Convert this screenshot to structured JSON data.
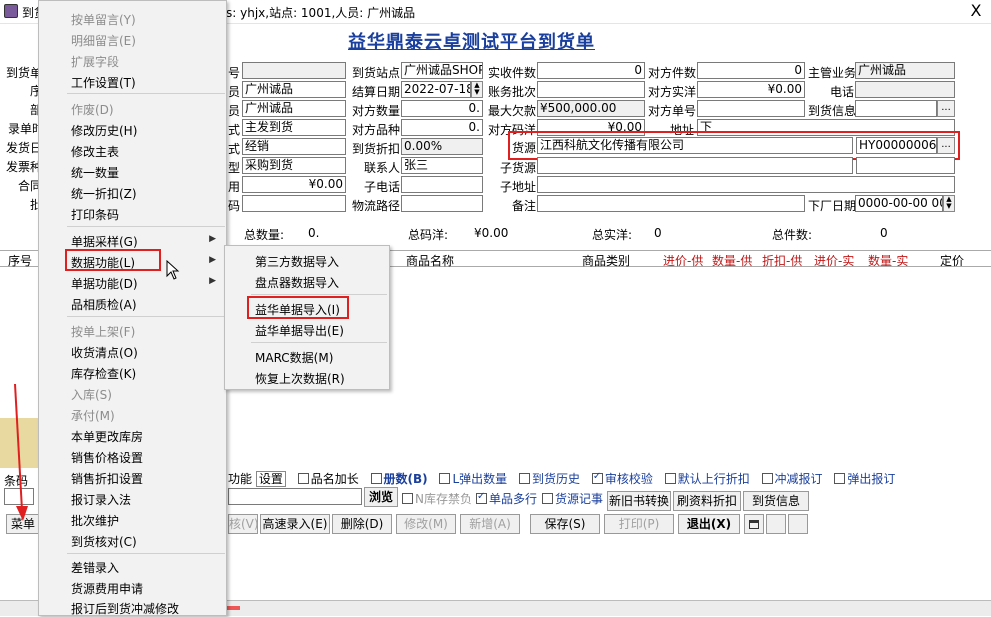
{
  "window": {
    "title": "到货",
    "user_info": "s: yhjx,站点: 1001,人员: 广州诚品",
    "close_label": "X"
  },
  "app_title": "益华鼎泰云卓测试平台到货单",
  "left_labels": [
    "到货单",
    "序",
    "部",
    "录单时",
    "发货日",
    "发票种",
    "合同",
    "批"
  ],
  "form": {
    "c1": {
      "labels": [
        "号",
        "员",
        "员",
        "式",
        "式",
        "型",
        "用",
        "码"
      ],
      "values": [
        "",
        "广州诚品",
        "广州诚品",
        "主发到货",
        "经销",
        "采购到货",
        "¥0.00",
        ""
      ]
    },
    "c2": {
      "labels": [
        "到货站点",
        "结算日期",
        "对方数量",
        "对方品种",
        "到货折扣",
        "联系人",
        "子电话",
        "物流路径"
      ],
      "values": [
        "广州诚品SHOP",
        "2022-07-18",
        "0.",
        "0.",
        "0.00%",
        "张三",
        "",
        ""
      ]
    },
    "c3": {
      "labels": [
        "实收件数",
        "账务批次",
        "最大欠款",
        "对方码洋"
      ],
      "values": [
        "0",
        "",
        "¥500,000.00",
        "¥0.00"
      ]
    },
    "c4": {
      "labels": [
        "对方件数",
        "对方实洋",
        "对方单号",
        "地址"
      ],
      "values": [
        "0",
        "¥0.00",
        "",
        "下"
      ]
    },
    "c5": {
      "labels": [
        "主管业务",
        "电话",
        "到货信息"
      ],
      "values": [
        "广州诚品",
        "",
        ""
      ]
    },
    "supplier_label": "货源",
    "supplier_name": "江西科航文化传播有限公司",
    "supplier_code": "HY00000006",
    "sub_labels": [
      "子货源",
      "子地址",
      "备注"
    ],
    "delivery_date_label": "下厂日期",
    "delivery_date_value": "0000-00-00 00:"
  },
  "summary": {
    "total_qty_label": "总数量:",
    "total_qty": "0.",
    "total_price_label": "总码洋:",
    "total_price": "¥0.00",
    "total_real_label": "总实洋:",
    "total_real": "0",
    "total_pieces_label": "总件数:",
    "total_pieces": "0"
  },
  "grid_headers": [
    "序号",
    "商品名称",
    "商品类别",
    "进价-供",
    "数量-供",
    "折扣-供",
    "进价-实",
    "数量-实",
    "定价"
  ],
  "options": {
    "items": [
      "功能",
      "设置",
      "品名加长",
      "册数(B)",
      "L弹出数量",
      "到货历史",
      "审核校验",
      "默认上行折扣",
      "冲减报订",
      "弹出报订"
    ],
    "checked": [
      false,
      false,
      false,
      false,
      false,
      false,
      true,
      false,
      false,
      false
    ]
  },
  "search_row": {
    "browse_label": "浏览",
    "n_label": "N库存禁负",
    "multi_label": "单品多行",
    "record_label": "货源记事",
    "btn1": "新旧书转换",
    "btn2": "刷资料折扣",
    "btn3": "到货信息",
    "left_label": "条码"
  },
  "buttons": {
    "audit": "核(V)",
    "fast": "高速录入(E)",
    "delete": "删除(D)",
    "modify": "修改(M)",
    "add": "新增(A)",
    "save": "保存(S)",
    "print": "打印(P)",
    "exit": "退出(X)",
    "menu": "菜单"
  },
  "menu1": {
    "items": [
      {
        "label": "按单留言(Y)",
        "disabled": true
      },
      {
        "label": "明细留言(E)",
        "disabled": true
      },
      {
        "label": "扩展字段",
        "disabled": true
      },
      {
        "label": "工作设置(T)",
        "disabled": false
      },
      {
        "label": "作废(D)",
        "disabled": true
      },
      {
        "label": "修改历史(H)",
        "disabled": false
      },
      {
        "label": "修改主表",
        "disabled": false
      },
      {
        "label": "统一数量",
        "disabled": false
      },
      {
        "label": "统一折扣(Z)",
        "disabled": false
      },
      {
        "label": "打印条码",
        "disabled": false
      },
      {
        "label": "单据采样(G)",
        "disabled": false
      },
      {
        "label": "数据功能(L)",
        "disabled": false
      },
      {
        "label": "单据功能(D)",
        "disabled": false
      },
      {
        "label": "品相质检(A)",
        "disabled": false
      },
      {
        "label": "按单上架(F)",
        "disabled": true
      },
      {
        "label": "收货清点(O)",
        "disabled": false
      },
      {
        "label": "库存检查(K)",
        "disabled": false
      },
      {
        "label": "入库(S)",
        "disabled": true
      },
      {
        "label": "承付(M)",
        "disabled": true
      },
      {
        "label": "本单更改库房",
        "disabled": false
      },
      {
        "label": "销售价格设置",
        "disabled": false
      },
      {
        "label": "销售折扣设置",
        "disabled": false
      },
      {
        "label": "报订录入法",
        "disabled": false
      },
      {
        "label": "批次维护",
        "disabled": false
      },
      {
        "label": "到货核对(C)",
        "disabled": false
      },
      {
        "label": "差错录入",
        "disabled": false
      },
      {
        "label": "货源费用申请",
        "disabled": false
      },
      {
        "label": "报订后到货冲减修改",
        "disabled": false
      }
    ]
  },
  "menu2": {
    "items": [
      "第三方数据导入",
      "盘点器数据导入",
      "益华单据导入(I)",
      "益华单据导出(E)",
      "MARC数据(M)",
      "恢复上次数据(R)"
    ]
  },
  "colors": {
    "title": "#1a3f9c",
    "highlight_border": "#e02020",
    "menu_hover": "#cce4f7"
  }
}
